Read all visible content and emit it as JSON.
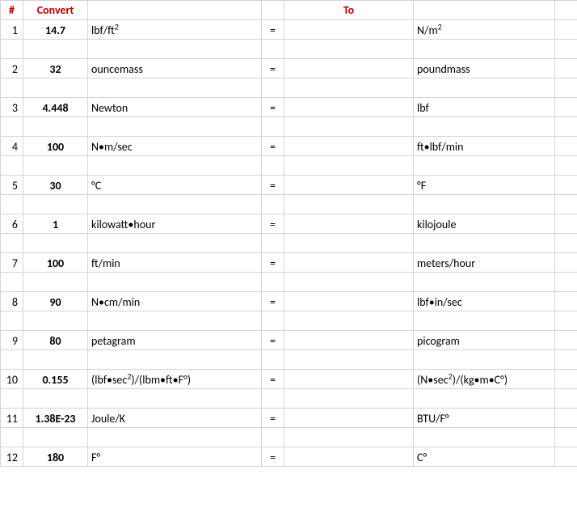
{
  "headers": {
    "num": "#",
    "convert": "Convert",
    "from": "",
    "eq": "",
    "to": "To",
    "tounit": "",
    "end": ""
  },
  "eq_symbol": "=",
  "rows": [
    {
      "n": "1",
      "value": "14.7",
      "from_unit": "lbf/ft²",
      "to_unit": "N/m²"
    },
    {
      "n": "2",
      "value": "32",
      "from_unit": "ouncemass",
      "to_unit": "poundmass"
    },
    {
      "n": "3",
      "value": "4.448",
      "from_unit": "Newton",
      "to_unit": "lbf"
    },
    {
      "n": "4",
      "value": "100",
      "from_unit": "N•m/sec",
      "to_unit": "ft•lbf/min"
    },
    {
      "n": "5",
      "value": "30",
      "from_unit": "°C",
      "to_unit": "°F"
    },
    {
      "n": "6",
      "value": "1",
      "from_unit": "kilowatt•hour",
      "to_unit": "kilojoule"
    },
    {
      "n": "7",
      "value": "100",
      "from_unit": "ft/min",
      "to_unit": "meters/hour"
    },
    {
      "n": "8",
      "value": "90",
      "from_unit": "N•cm/min",
      "to_unit": "lbf•in/sec"
    },
    {
      "n": "9",
      "value": "80",
      "from_unit": "petagram",
      "to_unit": "picogram"
    },
    {
      "n": "10",
      "value": "0.155",
      "from_unit": "(lbf•sec²)/(lbm•ft•F°)",
      "to_unit": "(N•sec²)/(kg•m•C°)"
    },
    {
      "n": "11",
      "value": "1.38E-23",
      "from_unit": "Joule/K",
      "to_unit": "BTU/F°"
    },
    {
      "n": "12",
      "value": "180",
      "from_unit": "F°",
      "to_unit": "C°"
    }
  ]
}
